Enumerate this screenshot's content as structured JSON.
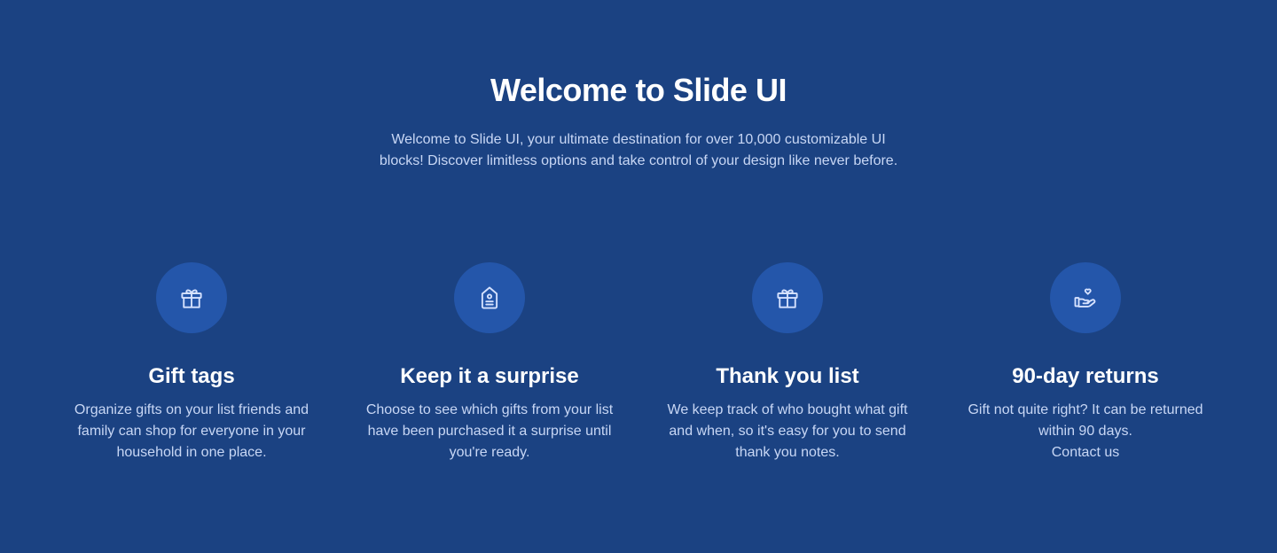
{
  "header": {
    "title": "Welcome to Slide UI",
    "subtitle": "Welcome to Slide UI, your ultimate destination for over 10,000 customizable UI blocks! Discover limitless options and take control of your design like never before."
  },
  "features": [
    {
      "icon": "gift-icon",
      "title": "Gift tags",
      "description": "Organize gifts on your list friends and family can shop for everyone in your household in one place."
    },
    {
      "icon": "tag-icon",
      "title": "Keep it a surprise",
      "description": "Choose to see which gifts from your list have been purchased it a surprise until you're ready."
    },
    {
      "icon": "gift-icon",
      "title": "Thank you list",
      "description": "We keep track of who bought what gift and when, so it's easy for you to send thank you notes."
    },
    {
      "icon": "hand-heart-icon",
      "title": "90-day returns",
      "description": "Gift not quite right? It can be returned within 90 days.",
      "link_label": "Contact us"
    }
  ],
  "colors": {
    "background": "#1b4282",
    "icon_circle": "#2456aa",
    "icon_stroke": "#d6e2ff",
    "body_text": "#c8d7f5",
    "heading_text": "#ffffff"
  }
}
